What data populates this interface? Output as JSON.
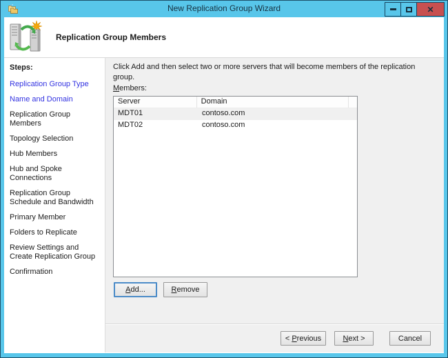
{
  "window": {
    "title": "New Replication Group Wizard",
    "controls": {
      "minimize_icon": "minimize-icon",
      "maximize_icon": "maximize-icon",
      "close_icon": "close-icon",
      "close_glyph": "✕"
    }
  },
  "header": {
    "title": "Replication Group Members",
    "icon": "replication-servers-icon"
  },
  "sidebar": {
    "heading": "Steps:",
    "steps": [
      {
        "label": "Replication Group Type",
        "state": "completed"
      },
      {
        "label": "Name and Domain",
        "state": "completed"
      },
      {
        "label": "Replication Group Members",
        "state": "current"
      },
      {
        "label": "Topology Selection",
        "state": "upcoming"
      },
      {
        "label": "Hub Members",
        "state": "upcoming"
      },
      {
        "label": "Hub and Spoke Connections",
        "state": "upcoming"
      },
      {
        "label": "Replication Group Schedule and Bandwidth",
        "state": "upcoming"
      },
      {
        "label": "Primary Member",
        "state": "upcoming"
      },
      {
        "label": "Folders to Replicate",
        "state": "upcoming"
      },
      {
        "label": "Review Settings and Create Replication Group",
        "state": "upcoming"
      },
      {
        "label": "Confirmation",
        "state": "upcoming"
      }
    ]
  },
  "main": {
    "instruction": "Click Add and then select two or more servers that will become members of the replication group.",
    "members_label": {
      "mnemonic": "M",
      "rest": "embers:"
    },
    "table": {
      "columns": [
        {
          "label": "Server"
        },
        {
          "label": "Domain"
        }
      ],
      "rows": [
        {
          "server": "MDT01",
          "domain": "contoso.com",
          "selected": true
        },
        {
          "server": "MDT02",
          "domain": "contoso.com",
          "selected": false
        }
      ]
    },
    "buttons": {
      "add": {
        "mnemonic": "A",
        "rest": "dd..."
      },
      "remove": {
        "mnemonic": "R",
        "rest": "emove"
      }
    }
  },
  "footer": {
    "previous": {
      "prefix": "< ",
      "mnemonic": "P",
      "rest": "revious"
    },
    "next": {
      "mnemonic": "N",
      "rest": "ext >"
    },
    "cancel": {
      "label": "Cancel"
    }
  },
  "colors": {
    "titlebar": "#58c6ea",
    "window_border": "#1d4e68",
    "close_button": "#c75050",
    "visited_link": "#3232e1",
    "content_bg": "#f0f0f0",
    "selection_bg": "#f0f0f0",
    "list_border": "#8a8d91",
    "focus_border": "#4b8bc8"
  }
}
